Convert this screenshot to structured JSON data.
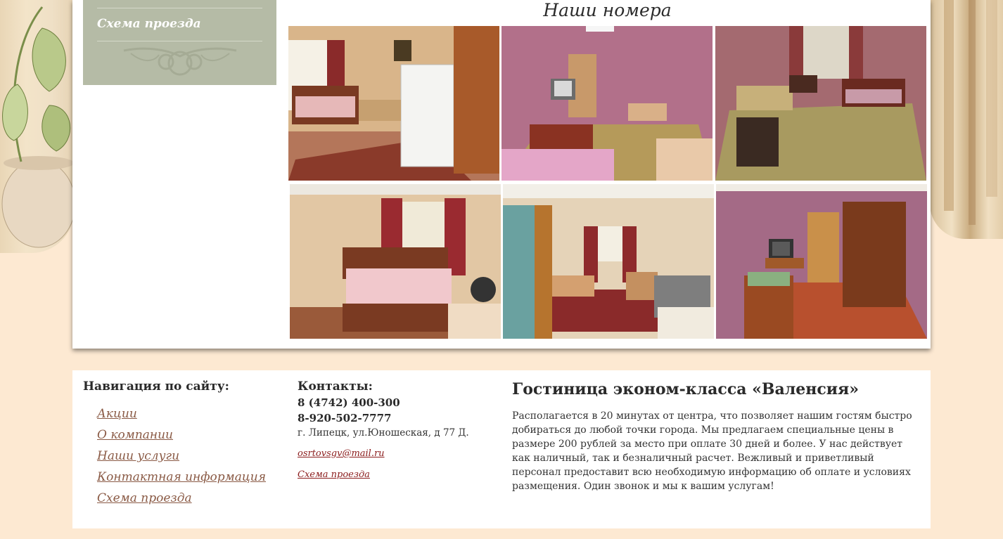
{
  "sidebar": {
    "link_label": "Схема проезда"
  },
  "gallery": {
    "title": "Наши номера",
    "photos": [
      "room-photo-1",
      "room-photo-2",
      "room-photo-3",
      "room-photo-4",
      "room-photo-5",
      "room-photo-6"
    ]
  },
  "footer": {
    "nav": {
      "heading": "Навигация по сайту:",
      "items": [
        "Акции",
        "О компании",
        "Наши услуги",
        "Контактная информация",
        "Схема проезда"
      ]
    },
    "contacts": {
      "heading": "Контакты:",
      "phone1": "8 (4742) 400-300",
      "phone2": "8-920-502-7777",
      "address": "г. Липецк, ул.Юношеская, д 77 Д.",
      "email": "osrtovsgv@mail.ru",
      "map_link": "Схема проезда"
    },
    "about": {
      "title": "Гостиница эконом-класса «Валенсия»",
      "text": "Располагается в 20 минутах от центра, что позволяет нашим гостям быстро добираться до любой точки города. Мы предлагаем специальные цены в размере 200 рублей за место при оплате 30 дней и более. У нас действует как наличный, так и безналичный расчет. Вежливый и приветливый персонал предоставит всю необходимую информацию об оплате и условиях размещения. Один звонок и мы к вашим услугам!"
    }
  },
  "colors": {
    "page_bg": "#fde9d2",
    "sidebar_bg": "#b5bba6",
    "nav_link": "#8a5a45",
    "contact_link": "#8b1c1c"
  }
}
